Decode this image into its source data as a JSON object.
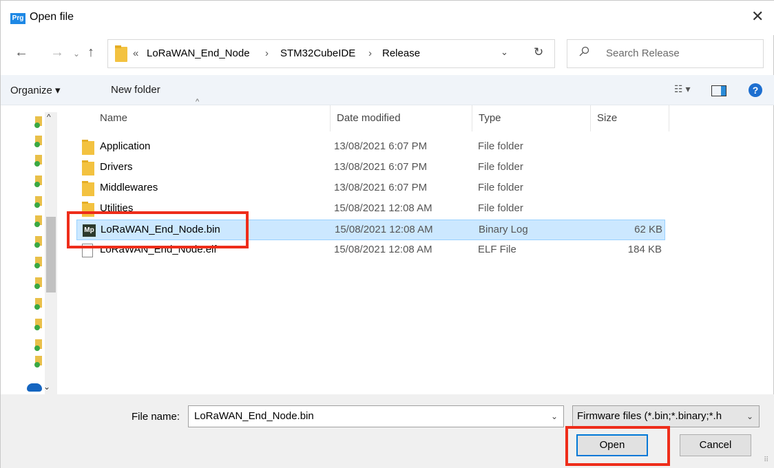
{
  "window": {
    "app_icon_text": "Prg",
    "title": "Open file",
    "close_glyph": "✕"
  },
  "navigation": {
    "back_glyph": "←",
    "forward_glyph": "→",
    "recent_glyph": "⌄",
    "up_glyph": "↑"
  },
  "address": {
    "overflow_glyph": "«",
    "separator_glyph": "›",
    "crumbs": [
      "LoRaWAN_End_Node",
      "STM32CubeIDE",
      "Release"
    ],
    "dropdown_glyph": "⌄",
    "refresh_glyph": "↻"
  },
  "search": {
    "placeholder": "Search Release"
  },
  "toolbar": {
    "organize_label": "Organize ▾",
    "new_folder_label": "New folder",
    "view_label": "☷ ▾",
    "help_label": "?"
  },
  "columns": {
    "name": "Name",
    "date": "Date modified",
    "type": "Type",
    "size": "Size",
    "sort_glyph": "^"
  },
  "files": [
    {
      "name": "Application",
      "date": "13/08/2021 6:07 PM",
      "type": "File folder",
      "size": "",
      "icon": "folder-icon"
    },
    {
      "name": "Drivers",
      "date": "13/08/2021 6:07 PM",
      "type": "File folder",
      "size": "",
      "icon": "folder-icon"
    },
    {
      "name": "Middlewares",
      "date": "13/08/2021 6:07 PM",
      "type": "File folder",
      "size": "",
      "icon": "folder-icon"
    },
    {
      "name": "Utilities",
      "date": "15/08/2021 12:08 AM",
      "type": "File folder",
      "size": "",
      "icon": "folder-icon"
    },
    {
      "name": "LoRaWAN_End_Node.bin",
      "date": "15/08/2021 12:08 AM",
      "type": "Binary Log",
      "size": "62 KB",
      "icon": "mp-file-icon",
      "selected": true
    },
    {
      "name": "LoRaWAN_End_Node.elf",
      "date": "15/08/2021 12:08 AM",
      "type": "ELF File",
      "size": "184 KB",
      "icon": "file-icon"
    }
  ],
  "mp_icon_text": "Mp",
  "footer": {
    "file_name_label": "File name:",
    "file_name_value": "LoRaWAN_End_Node.bin",
    "file_name_dropdown_glyph": "⌄",
    "filter_value": "Firmware files (*.bin;*.binary;*.h",
    "filter_dropdown_glyph": "⌄",
    "open_label": "Open",
    "cancel_label": "Cancel"
  },
  "nav_pane": {
    "scroll_up_glyph": "^",
    "scroll_down_glyph": "⌄"
  },
  "colors": {
    "accent": "#0078d7",
    "highlight": "#ee2d1a",
    "selection": "#cce8ff"
  }
}
